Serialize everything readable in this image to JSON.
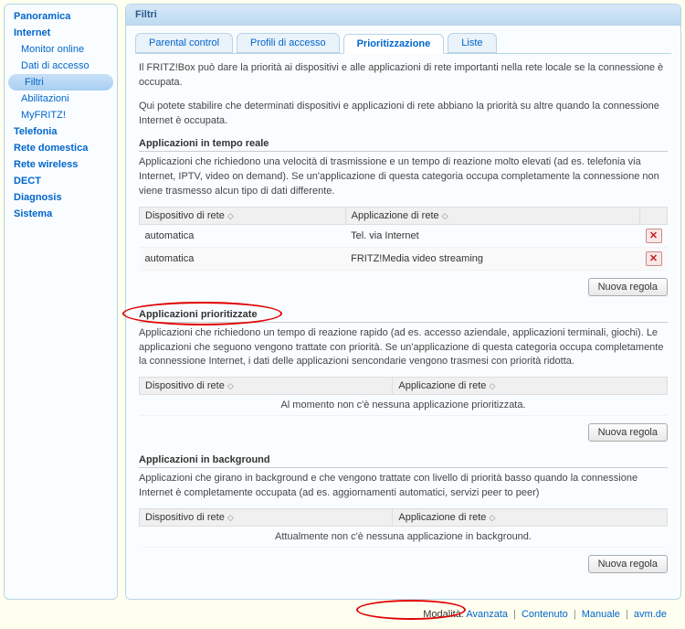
{
  "sidebar": {
    "items": [
      {
        "label": "Panoramica",
        "top": true
      },
      {
        "label": "Internet",
        "top": true
      },
      {
        "label": "Monitor online",
        "sub": true
      },
      {
        "label": "Dati di accesso",
        "sub": true
      },
      {
        "label": "Filtri",
        "sub": true,
        "active": true
      },
      {
        "label": "Abilitazioni",
        "sub": true
      },
      {
        "label": "MyFRITZ!",
        "sub": true
      },
      {
        "label": "Telefonia",
        "top": true
      },
      {
        "label": "Rete domestica",
        "top": true
      },
      {
        "label": "Rete wireless",
        "top": true
      },
      {
        "label": "DECT",
        "top": true
      },
      {
        "label": "Diagnosis",
        "top": true
      },
      {
        "label": "Sistema",
        "top": true
      }
    ]
  },
  "main": {
    "title": "Filtri",
    "tabs": [
      {
        "label": "Parental control"
      },
      {
        "label": "Profili di accesso"
      },
      {
        "label": "Prioritizzazione",
        "active": true
      },
      {
        "label": "Liste"
      }
    ],
    "intro1": "Il FRITZ!Box può dare la priorità ai dispositivi e alle applicazioni di rete importanti nella rete locale se la connessione è occupata.",
    "intro2": "Qui potete stabilire che determinati dispositivi e applicazioni di rete abbiano la priorità su altre quando la connessione Internet è occupata.",
    "col_device": "Dispositivo di rete",
    "col_app": "Applicazione di rete",
    "btn_newrule": "Nuova regola",
    "s1": {
      "title": "Applicazioni in tempo reale",
      "desc": "Applicazioni che richiedono una velocità di trasmissione e un tempo di reazione molto elevati (ad es. telefonia via Internet, IPTV, video on demand).\nSe un'applicazione di questa categoria occupa completamente la connessione non viene trasmesso alcun tipo di dati differente.",
      "rows": [
        {
          "device": "automatica",
          "app": "Tel. via Internet"
        },
        {
          "device": "automatica",
          "app": "FRITZ!Media video streaming"
        }
      ]
    },
    "s2": {
      "title": "Applicazioni prioritizzate",
      "desc": "Applicazioni che richiedono un tempo di reazione rapido (ad es. accesso aziendale, applicazioni terminali, giochi).\nLe applicazioni che seguono vengono trattate con priorità. Se un'applicazione di questa categoria occupa completamente la connessione Internet, i dati delle applicazioni sencondarie vengono trasmesi con priorità ridotta.",
      "empty": "Al momento non c'è nessuna applicazione prioritizzata."
    },
    "s3": {
      "title": "Applicazioni in background",
      "desc": "Applicazioni che girano in background e che vengono trattate con livello di priorità basso quando la connessione Internet è completamente occupata (ad es. aggiornamenti automatici, servizi peer to peer)",
      "empty": "Attualmente non c'è nessuna applicazione in background."
    }
  },
  "footer": {
    "mode_label": "Modalità:",
    "mode_value": "Avanzata",
    "links": [
      "Contenuto",
      "Manuale",
      "avm.de"
    ]
  }
}
